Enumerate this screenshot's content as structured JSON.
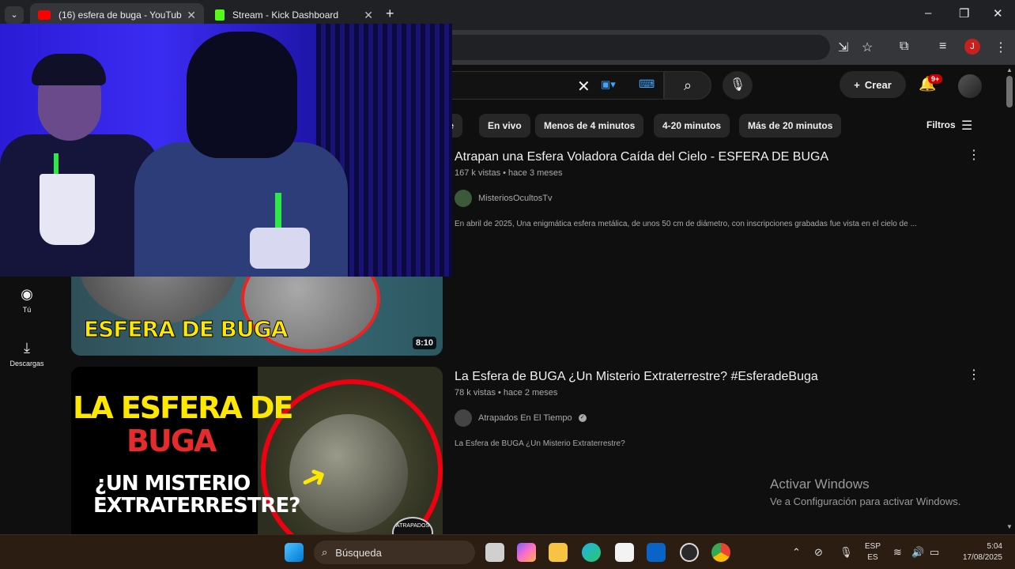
{
  "browser": {
    "tabs": [
      {
        "title": "(16) esfera de buga - YouTube",
        "active": true
      },
      {
        "title": "Stream - Kick Dashboard",
        "active": false
      }
    ],
    "profile_initial": "J"
  },
  "youtube": {
    "create_label": "Crear",
    "notifications_badge": "9+",
    "filters_label": "Filtros",
    "chips": [
      "nte",
      "En vivo",
      "Menos de 4 minutos",
      "4-20 minutos",
      "Más de 20 minutos"
    ],
    "sidebar": [
      {
        "label": "Tú",
        "icon": "user-circle-icon"
      },
      {
        "label": "Descargas",
        "icon": "download-icon"
      }
    ],
    "results": [
      {
        "title": "Atrapan una Esfera Voladora Caída del Cielo - ESFERA DE BUGA",
        "meta": "167 k vistas • hace 3 meses",
        "channel": "MisteriosOcultosTv",
        "verified": false,
        "description": "En abril de 2025, Una enigmática esfera metálica, de unos 50 cm de diámetro, con inscripciones grabadas fue vista en el cielo de ...",
        "thumbnail_text": "ESFERA DE BUGA",
        "duration": "8:10"
      },
      {
        "title": "La Esfera de BUGA ¿Un Misterio Extraterrestre? #EsferadeBuga",
        "meta": "78 k vistas • hace 2 meses",
        "channel": "Atrapados En El Tiempo",
        "verified": true,
        "description": "La Esfera de BUGA ¿Un Misterio Extraterrestre?",
        "thumbnail_line1": "LA ESFERA DE",
        "thumbnail_line2": "BUGA",
        "thumbnail_line3": "¿UN MISTERIO EXTRATERRESTRE?",
        "thumbnail_badge": "ATRAPADOS"
      }
    ]
  },
  "watermark": {
    "line1": "Activar Windows",
    "line2": "Ve a Configuración para activar Windows."
  },
  "taskbar": {
    "search_label": "Búsqueda",
    "lang_top": "ESP",
    "lang_bottom": "ES",
    "time": "5:04",
    "date": "17/08/2025"
  }
}
